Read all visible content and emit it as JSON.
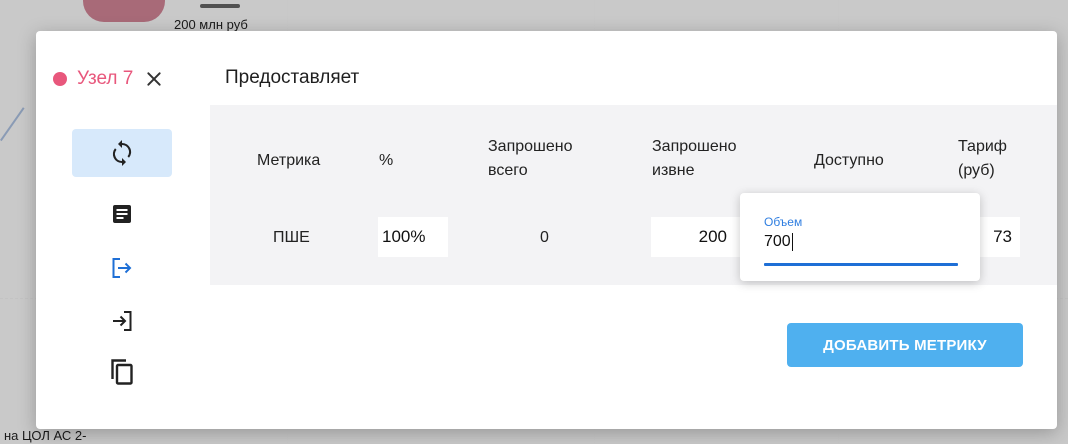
{
  "background": {
    "node_label": "200 млн руб",
    "bottom_label": "на ЦОЛ АС 2-"
  },
  "dialog": {
    "node_title": "Узел 7",
    "section_title": "Предоставляет",
    "accent_color": "#e8577c"
  },
  "rail": {
    "items": [
      {
        "icon": "refresh-icon",
        "active": true
      },
      {
        "icon": "document-icon",
        "active": false
      },
      {
        "icon": "export-icon",
        "active": false
      },
      {
        "icon": "import-icon",
        "active": false
      },
      {
        "icon": "copy-icon",
        "active": false
      }
    ]
  },
  "table": {
    "headers": {
      "metric": "Метрика",
      "percent": "%",
      "requested_total_1": "Запрошено",
      "requested_total_2": "всего",
      "requested_outside_1": "Запрошено",
      "requested_outside_2": "извне",
      "available": "Доступно",
      "tariff_1": "Тариф",
      "tariff_2": "(руб)"
    },
    "row": {
      "metric": "ПШЕ",
      "percent": "100%",
      "requested_total": "0",
      "requested_outside": "200",
      "tariff": "73"
    }
  },
  "popup": {
    "label": "Объем",
    "value": "700"
  },
  "add_button": {
    "label": "ДОБАВИТЬ МЕТРИКУ",
    "color": "#4fb0ef"
  }
}
